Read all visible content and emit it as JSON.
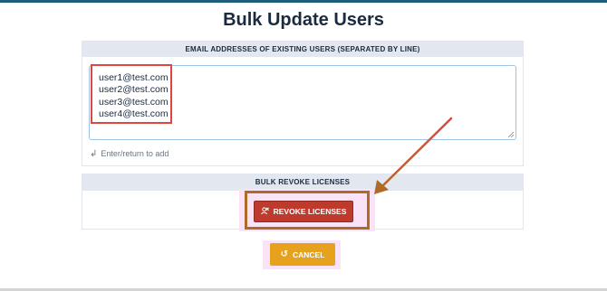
{
  "page": {
    "title": "Bulk Update Users"
  },
  "email_panel": {
    "header": "EMAIL ADDRESSES OF EXISTING USERS (SEPARATED BY LINE)",
    "emails": [
      "user1@test.com",
      "user2@test.com",
      "user3@test.com",
      "user4@test.com"
    ],
    "hint": "Enter/return to add",
    "hint_icon": "return-arrow-icon"
  },
  "revoke_panel": {
    "header": "BULK REVOKE LICENSES",
    "button_label": "REVOKE LICENSES",
    "button_icon": "user-remove-icon"
  },
  "cancel": {
    "label": "CANCEL",
    "icon": "undo-icon"
  },
  "colors": {
    "title_text": "#1b2a3f",
    "panel_header_bg": "#e3e8f0",
    "revoke_button": "#be3a2d",
    "cancel_button": "#e6a21d",
    "annotation_red": "#e0463d",
    "annotation_brown": "#b06a28",
    "highlight_pink": "#fbe3f7"
  }
}
